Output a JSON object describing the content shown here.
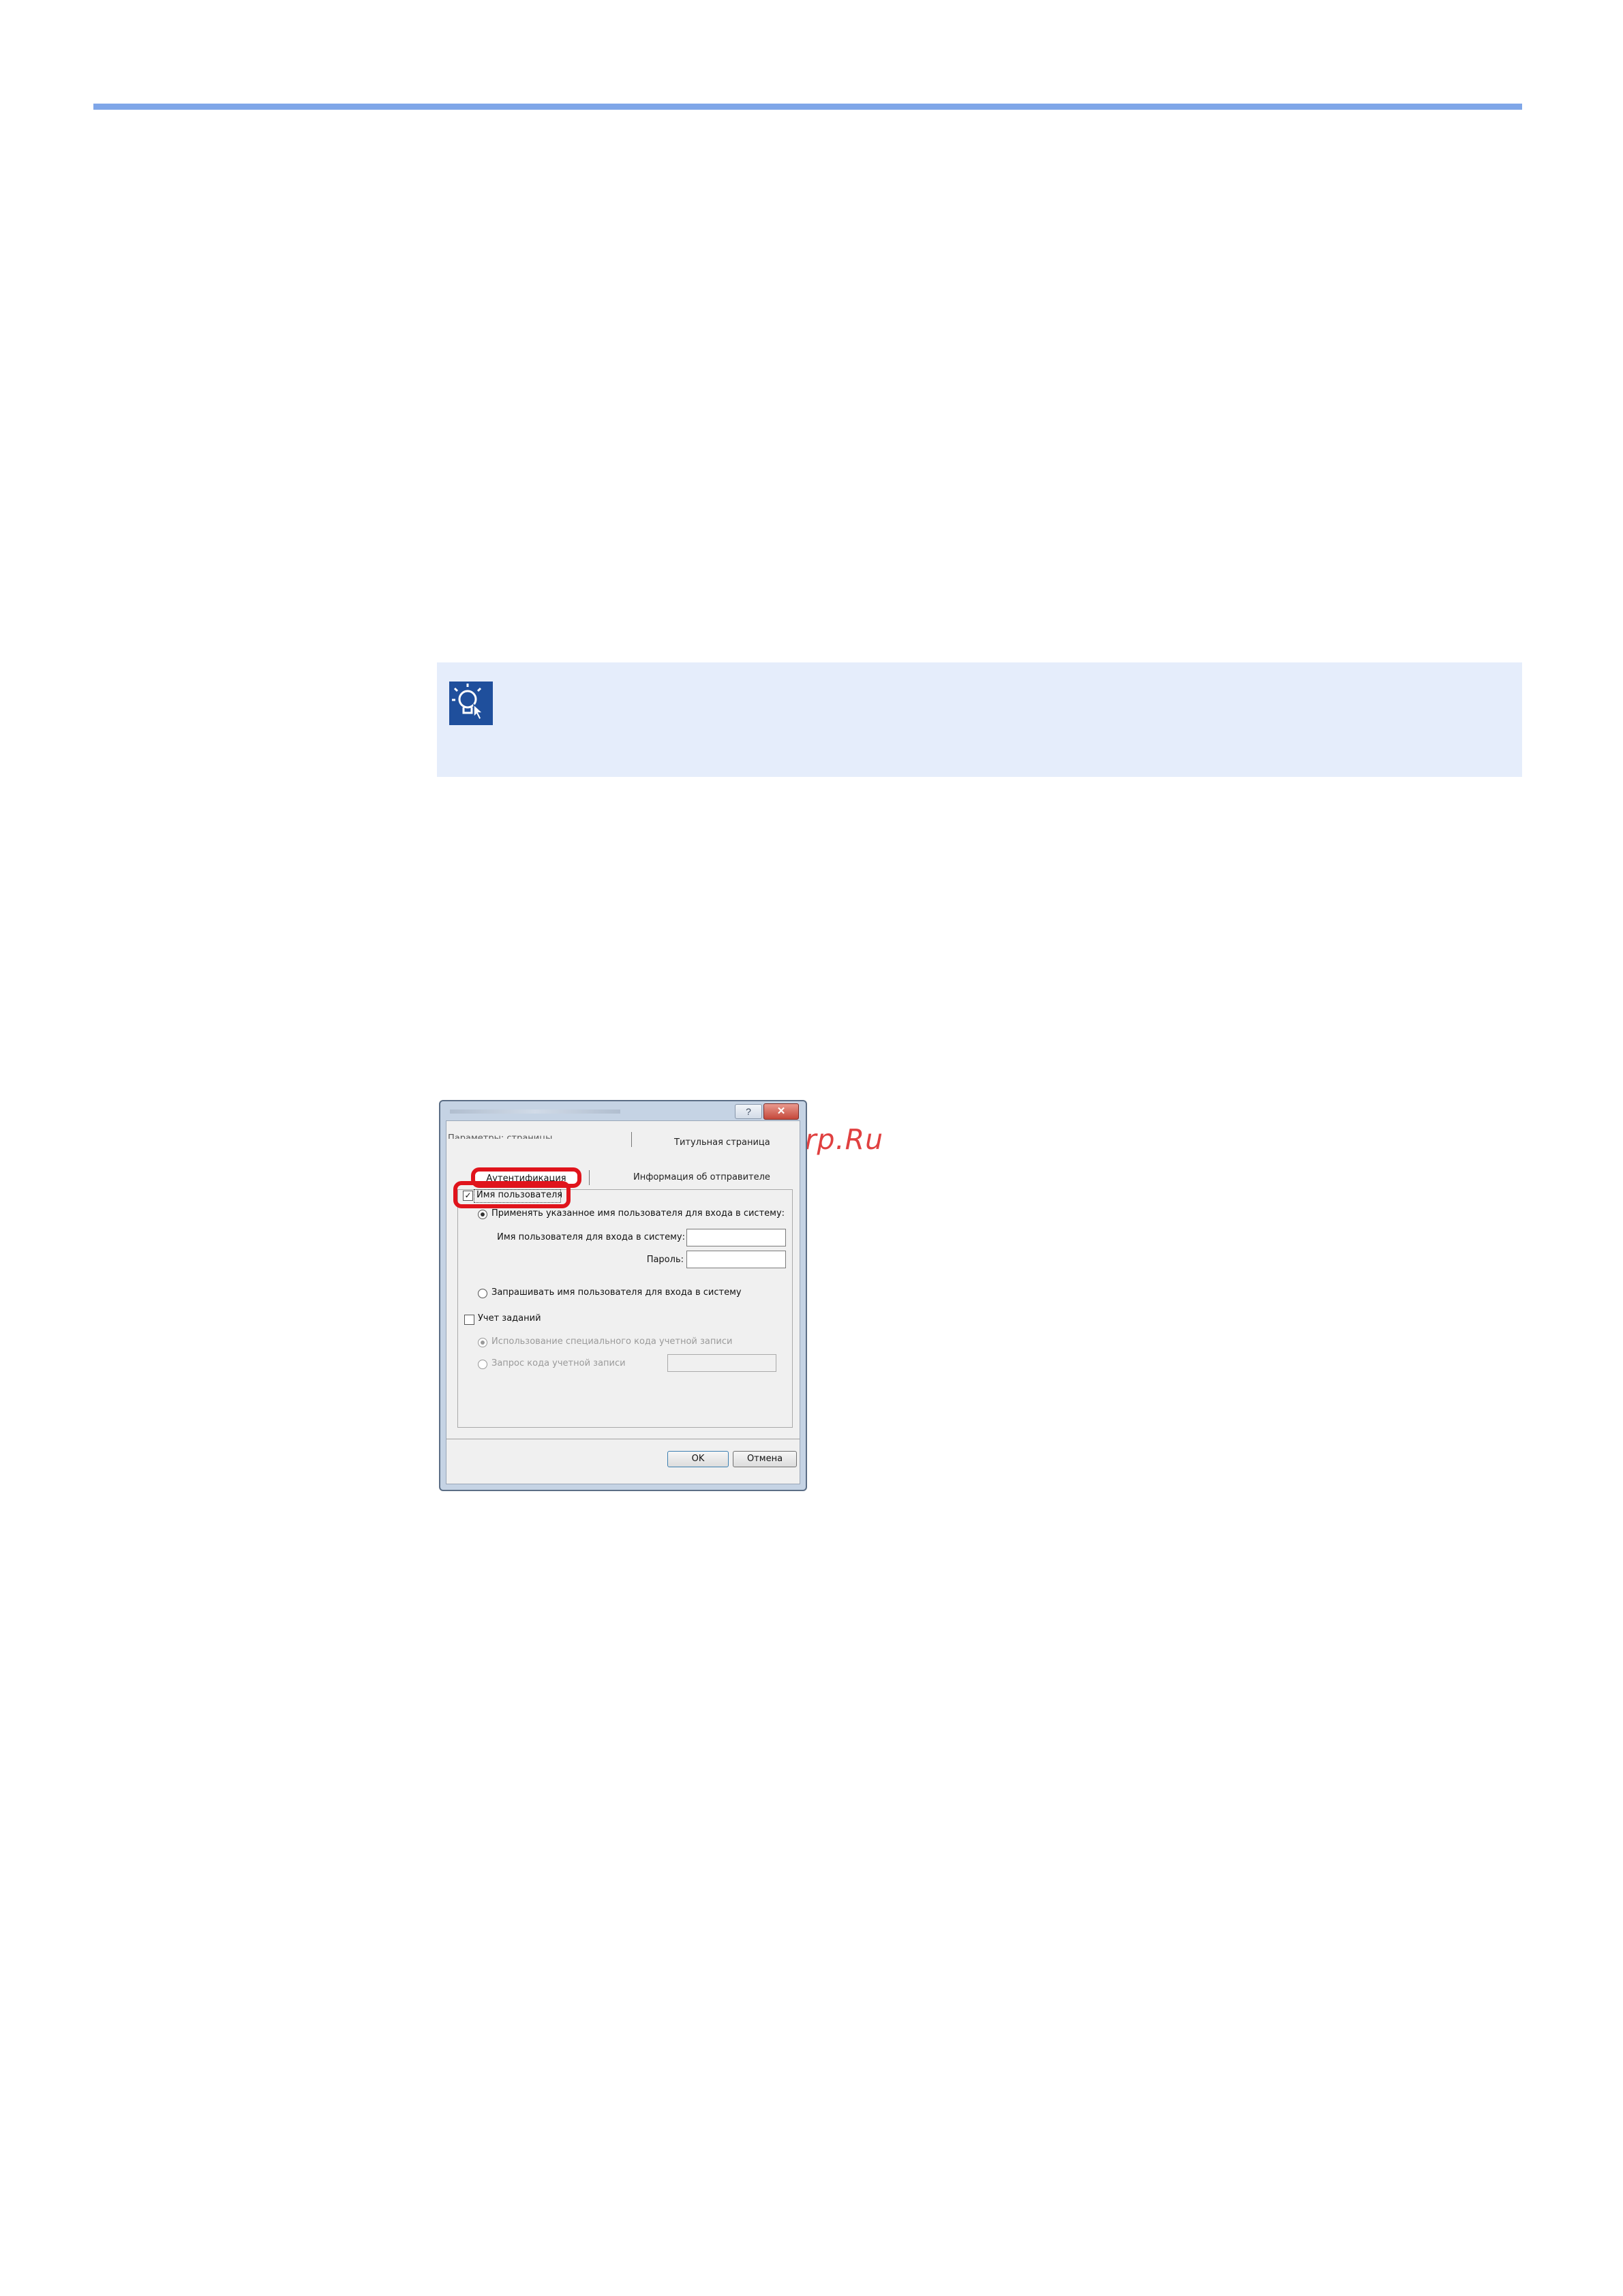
{
  "watermark": "McGrp.Ru",
  "dialog": {
    "help_glyph": "?",
    "close_glyph": "✕",
    "tabs": {
      "hidden_left": "Параметры: страницы",
      "title_page": "Титульная страница",
      "authentication": "Аутентификация",
      "sender_info": "Информация об отправителе"
    },
    "user_name_checkbox": {
      "label": "Имя пользователя",
      "checked_glyph": "✓"
    },
    "radio_use_specified": "Применять указанное имя пользователя для входа в систему:",
    "login_name_label": "Имя пользователя для входа в систему:",
    "login_name_value": "",
    "password_label": "Пароль:",
    "password_value": "",
    "radio_prompt": "Запрашивать имя пользователя для входа в систему",
    "job_accounting": {
      "label": "Учет заданий",
      "checked_glyph": ""
    },
    "radio_use_account_code": "Использование специального кода учетной записи",
    "radio_prompt_account_code": "Запрос кода учетной записи",
    "account_code_value": "",
    "ok_button": "OK",
    "cancel_button": "Отмена"
  },
  "icons": {
    "note": "lightbulb-hint-icon"
  },
  "colors": {
    "rule": "#7fa6e8",
    "note_background": "#e5edfb",
    "highlight": "#e0141c",
    "watermark": "#e04040"
  }
}
